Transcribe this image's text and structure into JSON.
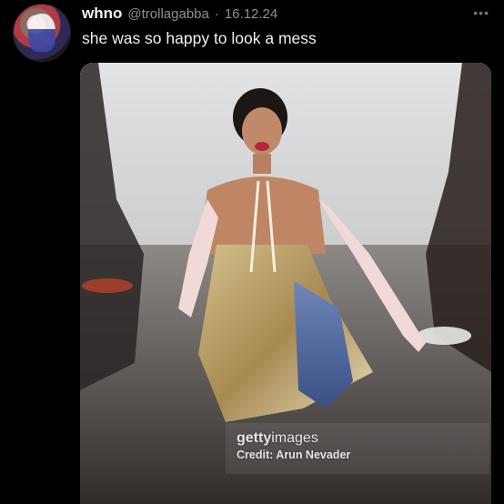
{
  "tweet": {
    "display_name": "whno",
    "handle": "@trollagabba",
    "separator": "·",
    "date": "16.12.24",
    "text": "she was so happy to look a mess",
    "more_icon": "more-options-icon",
    "avatar_icon": "profile-avatar"
  },
  "media": {
    "watermark_brand_bold": "getty",
    "watermark_brand_light": "images",
    "watermark_credit": "Credit: Arun Nevader"
  }
}
